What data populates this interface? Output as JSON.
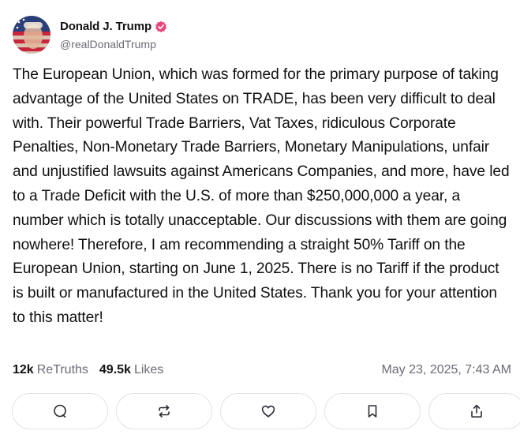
{
  "author": {
    "display_name": "Donald J. Trump",
    "handle": "@realDonaldTrump",
    "verified_color": "#e8467c"
  },
  "post": {
    "text": "The European Union, which was formed for the primary purpose of taking advantage of the United States on TRADE, has been very difficult to deal with. Their powerful Trade Barriers, Vat Taxes, ridiculous Corporate Penalties, Non-Monetary Trade Barriers, Monetary Manipulations, unfair and unjustified lawsuits against Americans Companies, and more, have led to a Trade Deficit with the U.S. of more than $250,000,000 a year, a number which is totally unacceptable. Our discussions with them are going nowhere! Therefore, I am recommending a straight 50% Tariff on the European Union, starting on June 1, 2025. There is no Tariff if the product is built or manufactured in the United States. Thank you for your attention to this matter!",
    "retruths_count": "12k",
    "retruths_label": "ReTruths",
    "likes_count": "49.5k",
    "likes_label": "Likes",
    "timestamp": "May 23, 2025, 7:43 AM"
  },
  "actions": [
    {
      "icon": "reply-icon"
    },
    {
      "icon": "retruth-icon"
    },
    {
      "icon": "like-icon"
    },
    {
      "icon": "bookmark-icon"
    },
    {
      "icon": "share-icon"
    }
  ]
}
